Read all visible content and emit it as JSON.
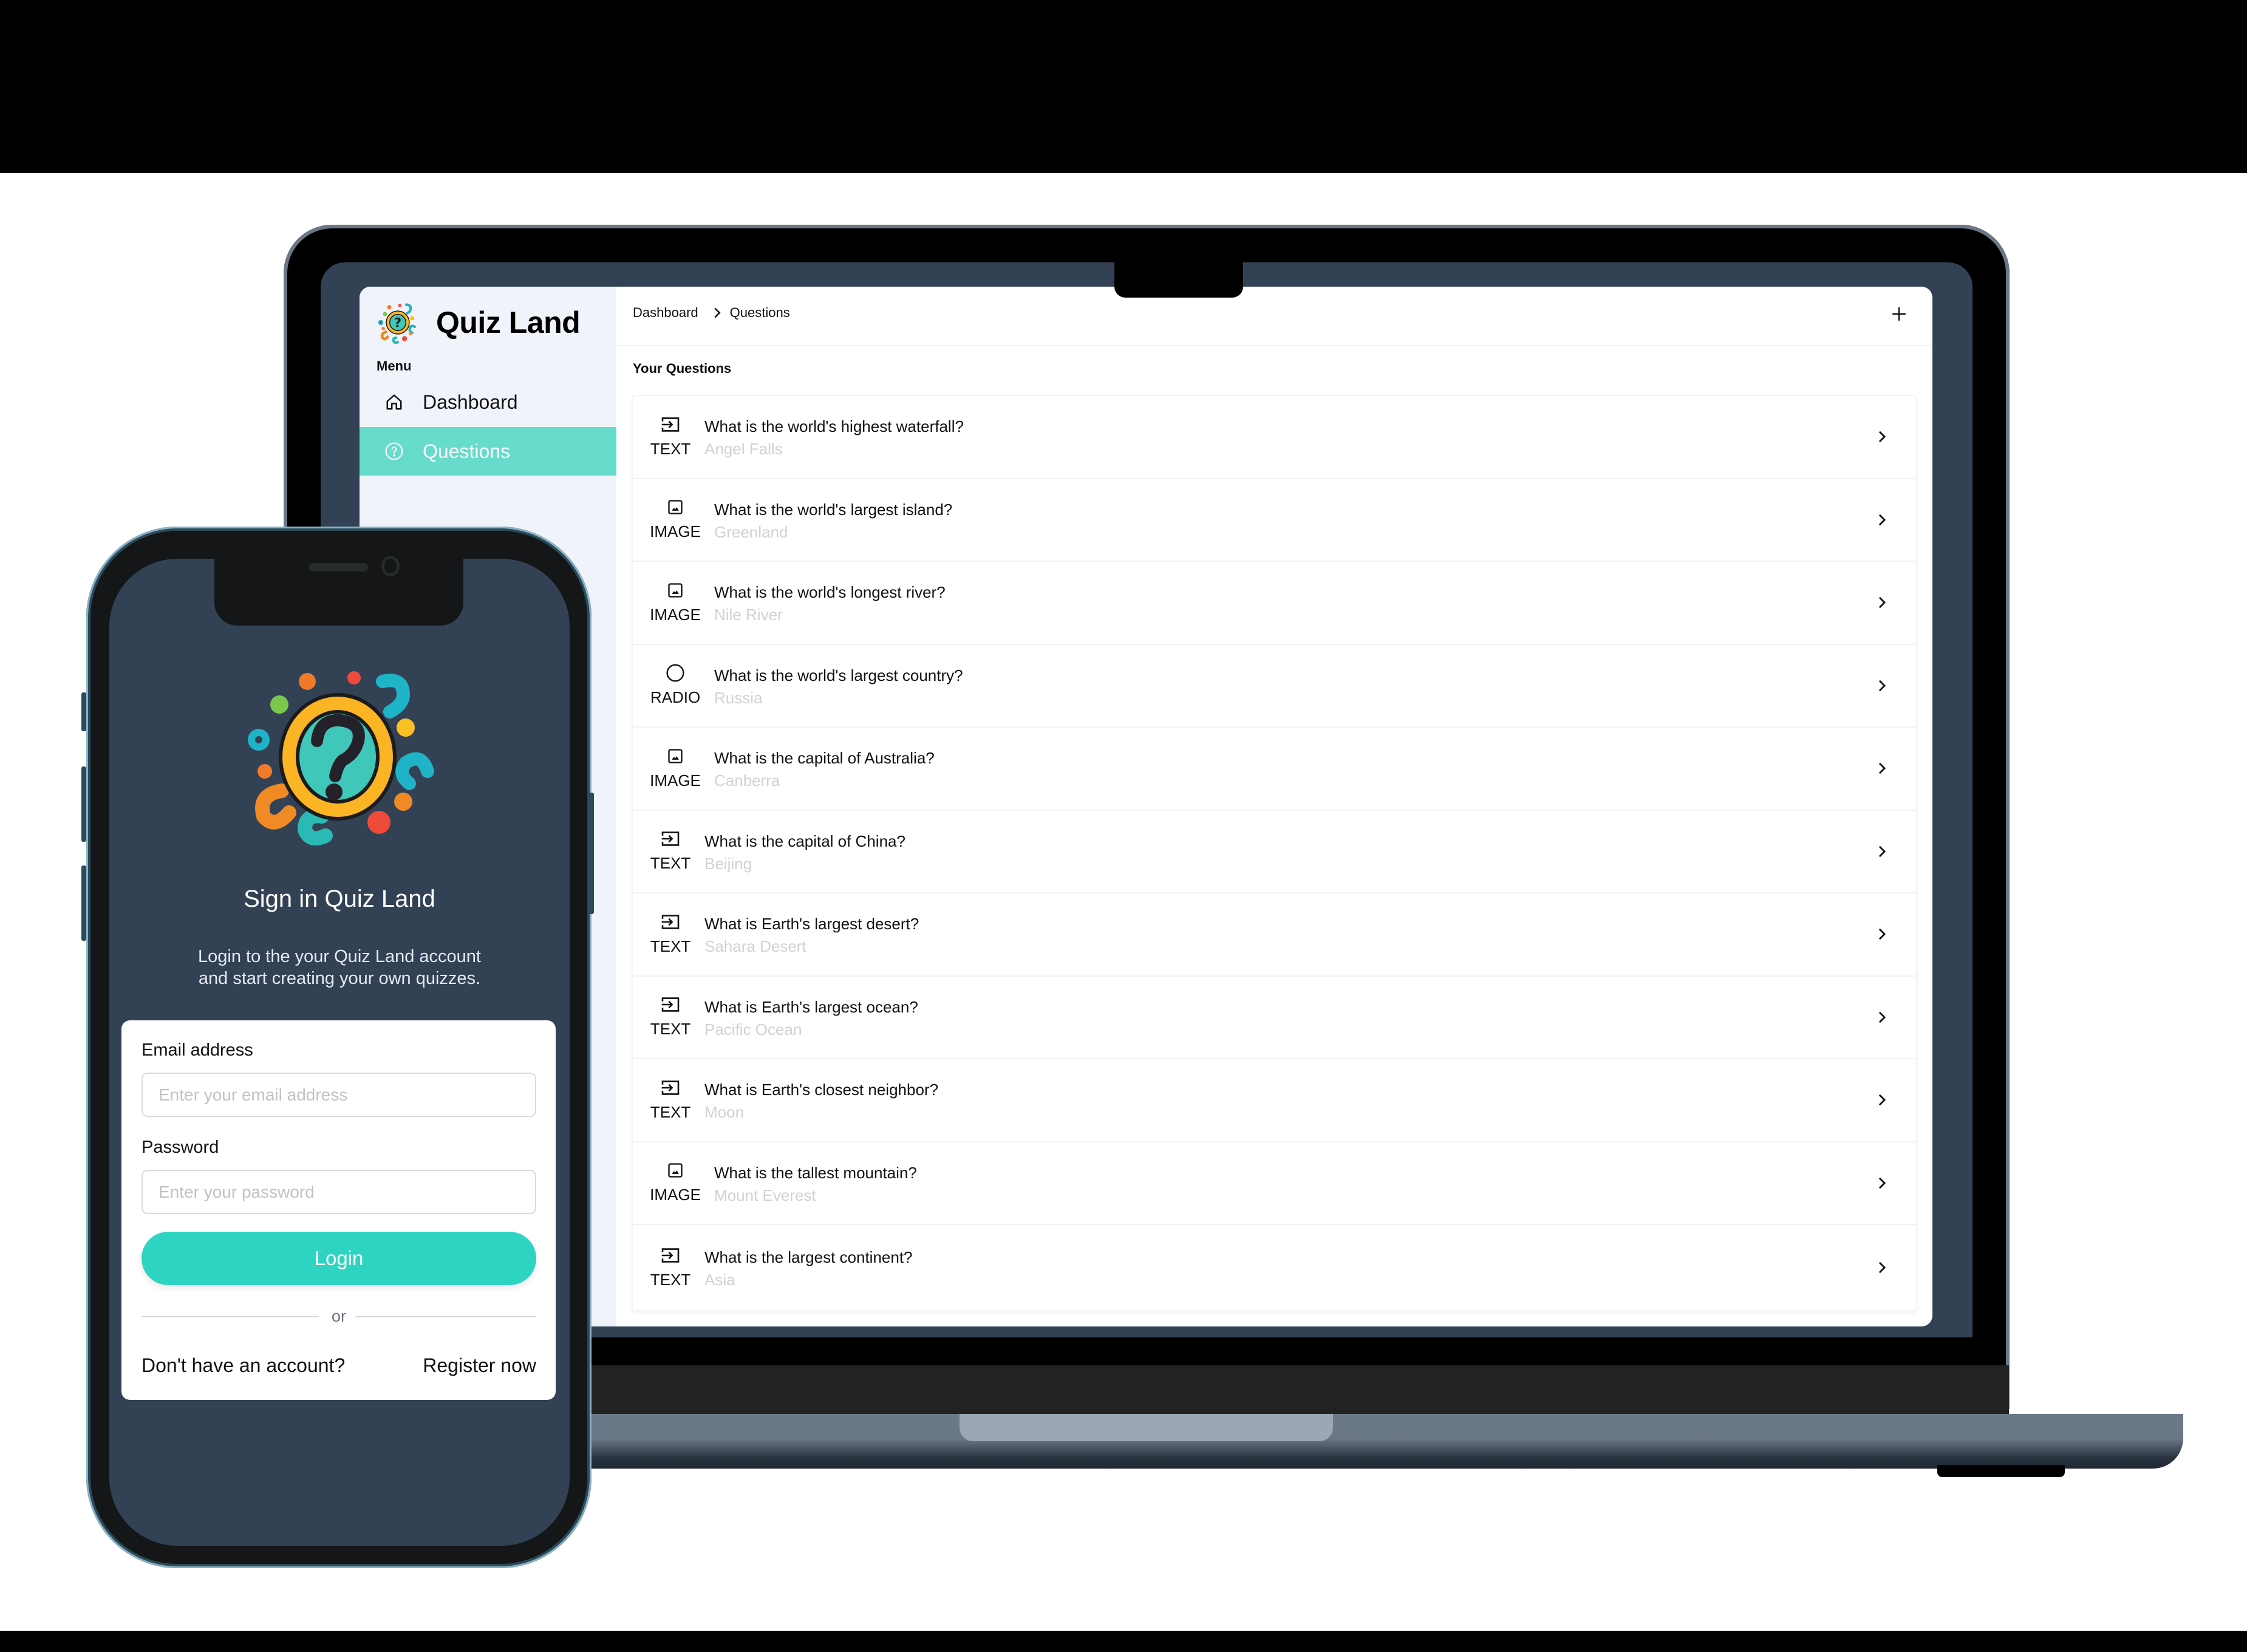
{
  "laptop": {
    "sidebar": {
      "brand": "Quiz Land",
      "menu_label": "Menu",
      "items": [
        {
          "label": "Dashboard",
          "icon": "home-icon",
          "active": false
        },
        {
          "label": "Questions",
          "icon": "question-circle-icon",
          "active": true
        }
      ]
    },
    "breadcrumb": [
      "Dashboard",
      "Questions"
    ],
    "add_button_icon": "plus-icon",
    "section_title": "Your Questions",
    "questions": [
      {
        "type": "TEXT",
        "icon": "text-input-icon",
        "question": "What is the world's highest waterfall?",
        "answer": "Angel Falls"
      },
      {
        "type": "IMAGE",
        "icon": "image-icon",
        "question": "What is the world's largest island?",
        "answer": "Greenland"
      },
      {
        "type": "IMAGE",
        "icon": "image-icon",
        "question": "What is the world's longest river?",
        "answer": "Nile River"
      },
      {
        "type": "RADIO",
        "icon": "radio-icon",
        "question": "What is the world's largest country?",
        "answer": "Russia"
      },
      {
        "type": "IMAGE",
        "icon": "image-icon",
        "question": "What is the capital of Australia?",
        "answer": "Canberra"
      },
      {
        "type": "TEXT",
        "icon": "text-input-icon",
        "question": "What is the capital of China?",
        "answer": "Beijing"
      },
      {
        "type": "TEXT",
        "icon": "text-input-icon",
        "question": "What is Earth's largest desert?",
        "answer": "Sahara Desert"
      },
      {
        "type": "TEXT",
        "icon": "text-input-icon",
        "question": "What is Earth's largest ocean?",
        "answer": "Pacific Ocean"
      },
      {
        "type": "TEXT",
        "icon": "text-input-icon",
        "question": "What is Earth's closest neighbor?",
        "answer": "Moon"
      },
      {
        "type": "IMAGE",
        "icon": "image-icon",
        "question": "What is the tallest mountain?",
        "answer": "Mount Everest"
      },
      {
        "type": "TEXT",
        "icon": "text-input-icon",
        "question": "What is the largest continent?",
        "answer": "Asia"
      }
    ]
  },
  "phone": {
    "title": "Sign in Quiz Land",
    "subtitle_line1": "Login to the your Quiz Land account",
    "subtitle_line2": "and start creating your own quizzes.",
    "email_label": "Email address",
    "email_placeholder": "Enter your email address",
    "email_value": "",
    "password_label": "Password",
    "password_placeholder": "Enter your password",
    "password_value": "",
    "login_label": "Login",
    "or_label": "or",
    "no_account_label": "Don't have an account?",
    "register_label": "Register now"
  },
  "colors": {
    "accent": "#2ed3c1",
    "sidebar_active": "#67dbcc",
    "screen_bg": "#334155",
    "sidebar_bg": "#f0f4fa",
    "answer_text": "#cfd2d6"
  }
}
